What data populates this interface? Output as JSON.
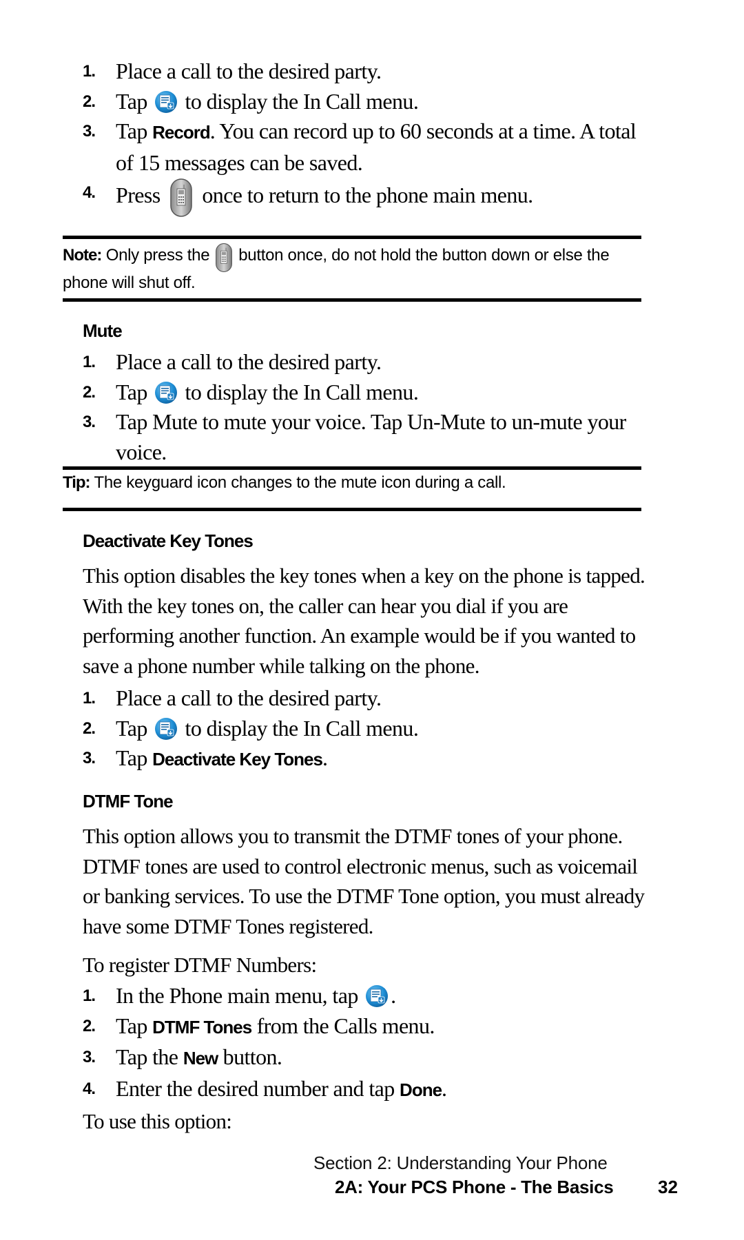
{
  "record_steps": [
    {
      "num": "1.",
      "text": "Place a call to the desired party."
    },
    {
      "num": "2.",
      "pre": "Tap",
      "icon": "in-call-menu-icon",
      "post": "to display the In Call menu."
    },
    {
      "num": "3.",
      "pre": "Tap ",
      "bold": "Record",
      "post": ". You can record up to 60 seconds at a time. A total of 15 messages can be saved."
    },
    {
      "num": "4.",
      "pre": "Press",
      "icon": "end-key-icon",
      "post": "once to return to the phone main menu."
    }
  ],
  "note": {
    "label": "Note:",
    "pre": "Only press the",
    "icon": "end-key-icon",
    "post": "button once, do not hold the button down or else the phone will shut off."
  },
  "mute": {
    "heading": "Mute",
    "steps": [
      {
        "num": "1.",
        "text": "Place a call to the desired party."
      },
      {
        "num": "2.",
        "pre": "Tap",
        "icon": "in-call-menu-icon",
        "post": "to display the In Call menu."
      },
      {
        "num": "3.",
        "text": "Tap Mute to mute your voice. Tap Un-Mute to un-mute your voice."
      }
    ]
  },
  "tip": {
    "label": "Tip:",
    "text": "The keyguard icon changes to the mute icon during a call."
  },
  "deactivate": {
    "heading": "Deactivate Key Tones",
    "paragraph": "This option disables the key tones when a key on the phone is tapped. With the key tones on, the caller can hear you dial if you are performing another function. An example would be if you wanted to save a phone number while talking on the phone.",
    "steps": [
      {
        "num": "1.",
        "text": "Place a call to the desired party."
      },
      {
        "num": "2.",
        "pre": "Tap",
        "icon": "in-call-menu-icon",
        "post": "to display the In Call menu."
      },
      {
        "num": "3.",
        "pre": "Tap ",
        "bold": "Deactivate Key Tones",
        "post": "."
      }
    ]
  },
  "dtmf": {
    "heading": "DTMF Tone",
    "paragraph": "This option allows you to transmit the DTMF tones of your phone. DTMF tones are used to control electronic menus, such as voicemail or banking services. To use the DTMF Tone option, you must already have some DTMF Tones registered.",
    "register_intro": "To register DTMF Numbers:",
    "steps": [
      {
        "num": "1.",
        "pre": "In the Phone main menu, tap",
        "icon": "in-call-menu-icon",
        "post": "."
      },
      {
        "num": "2.",
        "pre": "Tap ",
        "bold": "DTMF Tones",
        "post": " from the Calls menu."
      },
      {
        "num": "3.",
        "pre": "Tap the ",
        "bold": "New",
        "post": " button."
      },
      {
        "num": "4.",
        "pre": "Enter the desired number and tap ",
        "bold": "Done",
        "post": "."
      }
    ],
    "use_intro": "To use this option:"
  },
  "footer": {
    "section": "Section 2: Understanding Your Phone",
    "chapter": "2A: Your PCS Phone - The Basics",
    "page": "32"
  }
}
